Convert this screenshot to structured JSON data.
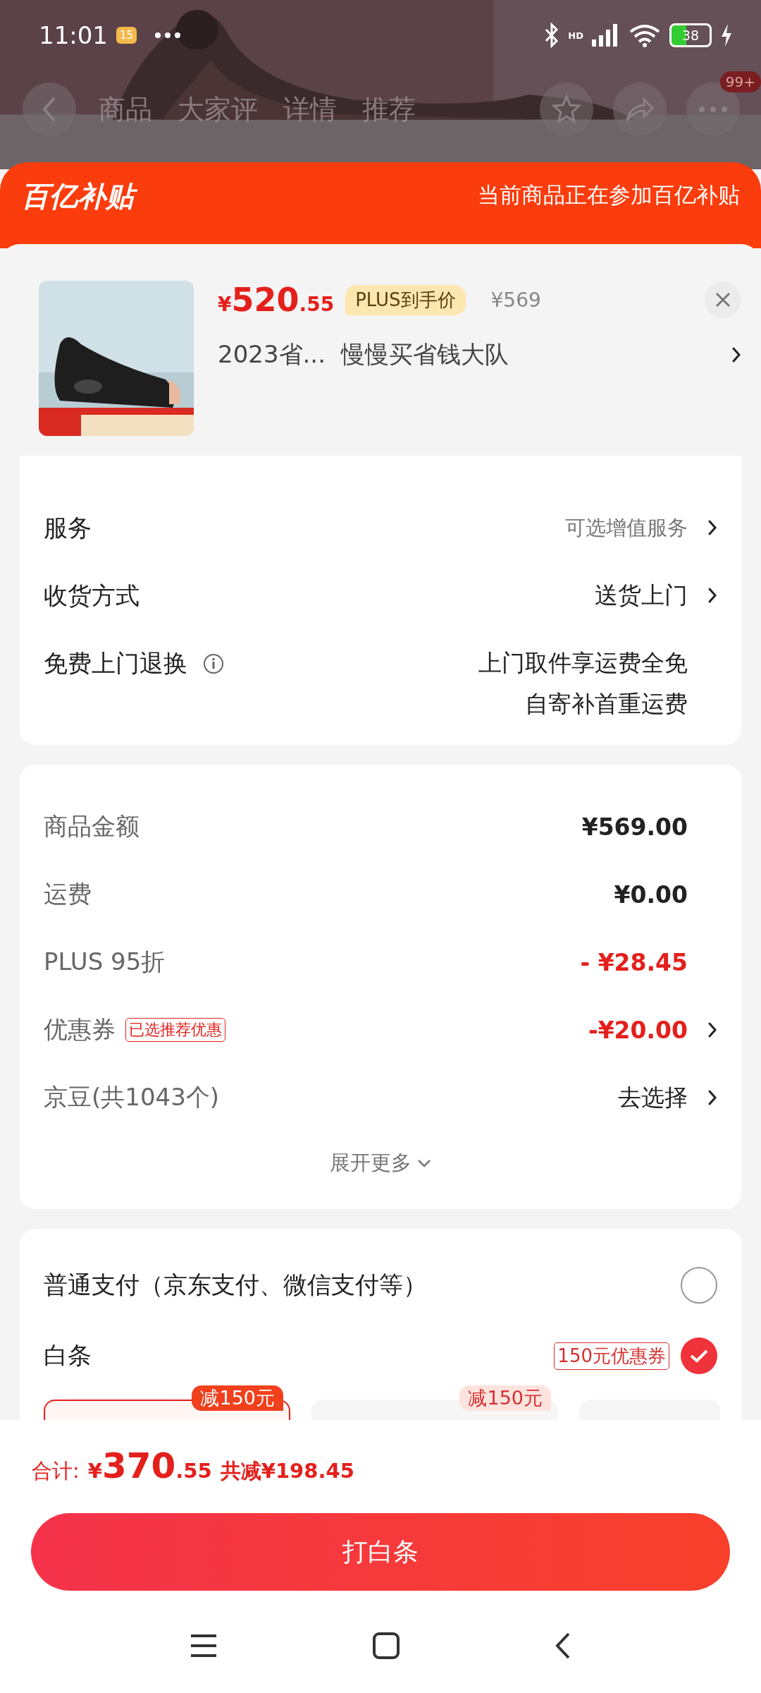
{
  "status_bar": {
    "time": "11:01",
    "notification_badge": "15",
    "network_label": "HD",
    "battery": "38"
  },
  "nav": {
    "tabs": [
      {
        "label": "商品",
        "selected": false
      },
      {
        "label": "大家评",
        "selected": false
      },
      {
        "label": "详情",
        "selected": false
      },
      {
        "label": "推荐",
        "selected": false
      }
    ],
    "badge": "99+"
  },
  "banner": {
    "logo": "百亿补贴",
    "text": "当前商品正在参加百亿补贴"
  },
  "product": {
    "currency": "¥",
    "price_int": "520",
    "price_dec": ".55",
    "plus_tag": "PLUS到手价",
    "original_price": "¥569",
    "title": "2023省...  慢慢买省钱大队"
  },
  "options": [
    {
      "label": "服务",
      "value_lines": [
        "可选增值服务"
      ],
      "kind": "muted",
      "chevron": true,
      "info": false
    },
    {
      "label": "收货方式",
      "value_lines": [
        "送货上门"
      ],
      "kind": "normal",
      "chevron": true,
      "info": false
    },
    {
      "label": "免费上门退换",
      "value_lines": [
        "上门取件享运费全免",
        "自寄补首重运费"
      ],
      "kind": "normal",
      "chevron": false,
      "info": true
    }
  ],
  "costs": {
    "rows": [
      {
        "label": "商品金额",
        "value": "¥569.00",
        "kind": "amount",
        "chevron": false
      },
      {
        "label": "运费",
        "value": "¥0.00",
        "kind": "amount",
        "chevron": false
      },
      {
        "label": "PLUS 95折",
        "value": "- ¥28.45",
        "kind": "discount",
        "chevron": false
      },
      {
        "label": "优惠券",
        "tag": "已选推荐优惠",
        "value": "-¥20.00",
        "kind": "discount",
        "chevron": true
      },
      {
        "label": "京豆(共1043个)",
        "value": "去选择",
        "kind": "normal",
        "chevron": true
      }
    ],
    "expand": "展开更多"
  },
  "payment": {
    "methods": [
      {
        "label": "普通支付（京东支付、微信支付等）",
        "selected": false
      },
      {
        "label": "白条",
        "tag": "150元优惠券",
        "selected": true
      }
    ],
    "coupons": [
      {
        "badge": "减150元",
        "selected": true
      },
      {
        "badge": "减150元",
        "selected": false
      },
      {
        "selected": false
      }
    ]
  },
  "footer": {
    "total_label": "合计:",
    "currency": "¥",
    "total_int": "370",
    "total_dec": ".55",
    "saving": "共减¥198.45",
    "button": "打白条"
  }
}
